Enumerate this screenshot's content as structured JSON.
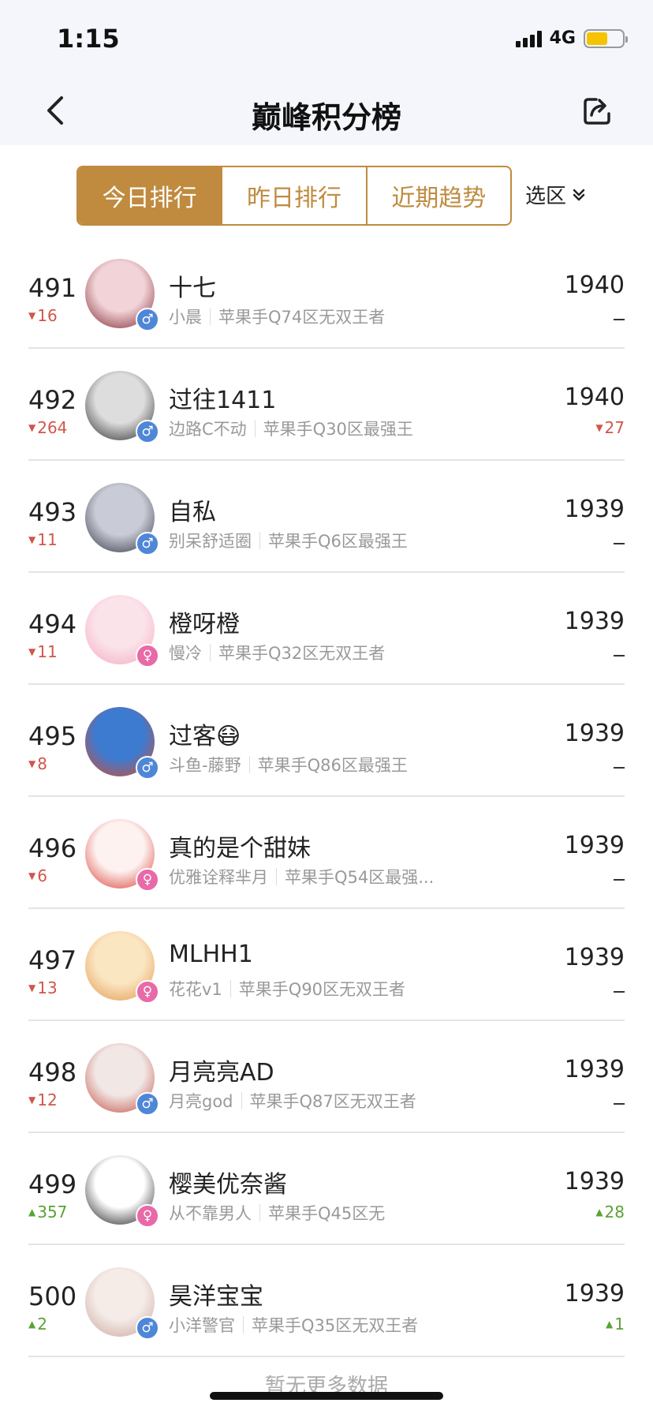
{
  "status": {
    "time": "1:15",
    "network": "4G",
    "battery_level": 0.6,
    "battery_color": "#f5c400"
  },
  "nav": {
    "title": "巅峰积分榜",
    "back_icon": "chevron-left-icon",
    "share_icon": "share-icon"
  },
  "tabs": [
    {
      "label": "今日排行",
      "active": true
    },
    {
      "label": "昨日排行",
      "active": false
    },
    {
      "label": "近期趋势",
      "active": false
    }
  ],
  "region": {
    "label": "选区",
    "icon": "double-chevron-down-icon"
  },
  "accent_color": "#c08b3f",
  "rows": [
    {
      "rank": "491",
      "rank_dir": "down",
      "rank_delta": "16",
      "name": "十七",
      "nickname": "小晨",
      "server": "苹果手Q74区无双王者",
      "gender": "male",
      "score": "1940",
      "score_dir": "none",
      "score_delta": ""
    },
    {
      "rank": "492",
      "rank_dir": "down",
      "rank_delta": "264",
      "name": "过往1411",
      "nickname": "边路C不动",
      "server": "苹果手Q30区最强王",
      "gender": "male",
      "score": "1940",
      "score_dir": "down",
      "score_delta": "27"
    },
    {
      "rank": "493",
      "rank_dir": "down",
      "rank_delta": "11",
      "name": "自私",
      "nickname": "别呆舒适圈",
      "server": "苹果手Q6区最强王",
      "gender": "male",
      "score": "1939",
      "score_dir": "none",
      "score_delta": ""
    },
    {
      "rank": "494",
      "rank_dir": "down",
      "rank_delta": "11",
      "name": "橙呀橙",
      "nickname": "慢冷",
      "server": "苹果手Q32区无双王者",
      "gender": "female",
      "score": "1939",
      "score_dir": "none",
      "score_delta": ""
    },
    {
      "rank": "495",
      "rank_dir": "down",
      "rank_delta": "8",
      "name": "过客😷",
      "nickname": "斗鱼-藤野",
      "server": "苹果手Q86区最强王",
      "gender": "male",
      "score": "1939",
      "score_dir": "none",
      "score_delta": ""
    },
    {
      "rank": "496",
      "rank_dir": "down",
      "rank_delta": "6",
      "name": "真的是个甜妹",
      "nickname": "优雅诠释芈月",
      "server": "苹果手Q54区最强...",
      "gender": "female",
      "score": "1939",
      "score_dir": "none",
      "score_delta": ""
    },
    {
      "rank": "497",
      "rank_dir": "down",
      "rank_delta": "13",
      "name": "MLHH1",
      "nickname": "花花v1",
      "server": "苹果手Q90区无双王者",
      "gender": "female",
      "score": "1939",
      "score_dir": "none",
      "score_delta": ""
    },
    {
      "rank": "498",
      "rank_dir": "down",
      "rank_delta": "12",
      "name": "月亮亮AD",
      "nickname": "月亮god",
      "server": "苹果手Q87区无双王者",
      "gender": "male",
      "score": "1939",
      "score_dir": "none",
      "score_delta": ""
    },
    {
      "rank": "499",
      "rank_dir": "up",
      "rank_delta": "357",
      "name": "樱美优奈酱",
      "nickname": "从不靠男人",
      "server": "苹果手Q45区无",
      "gender": "female",
      "score": "1939",
      "score_dir": "up",
      "score_delta": "28"
    },
    {
      "rank": "500",
      "rank_dir": "up",
      "rank_delta": "2",
      "name": "昊洋宝宝",
      "nickname": "小洋警官",
      "server": "苹果手Q35区无双王者",
      "gender": "male",
      "score": "1939",
      "score_dir": "up",
      "score_delta": "1"
    }
  ],
  "footer": {
    "note": "暂无更多数据"
  }
}
